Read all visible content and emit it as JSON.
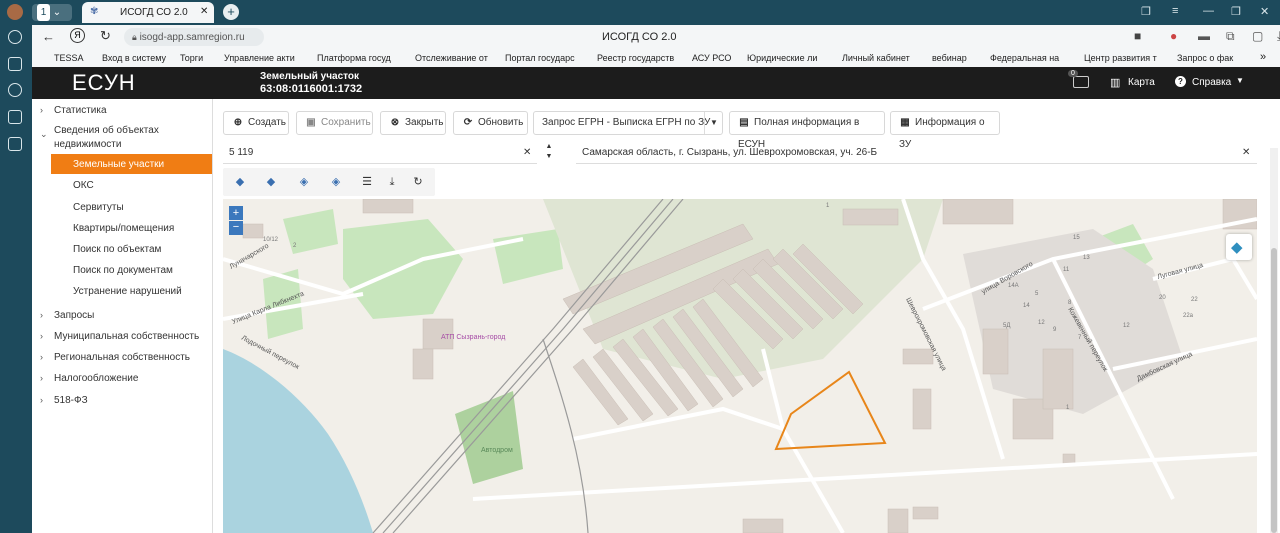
{
  "browser": {
    "tab_count": "1",
    "tab_title": "ИСОГД СО 2.0",
    "url": "isogd-app.samregion.ru",
    "page_title": "ИСОГД СО 2.0",
    "bookmarks": [
      "TESSA",
      "Вход в систему",
      "Торги",
      "Управление акти",
      "Платформа госуд",
      "Отслеживание от",
      "Портал государс",
      "Реестр государств",
      "АСУ РСО",
      "Юридические ли",
      "Личный кабинет",
      "вебинар",
      "Федеральная на",
      "Центр развития т",
      "Запрос о фак"
    ],
    "more_bookmarks": "»"
  },
  "app": {
    "logo": "ЕСУН",
    "record_type": "Земельный участок",
    "record_id": "63:08:0116001:1732",
    "notif_count": "0",
    "map_label": "Карта",
    "help_label": "Справка"
  },
  "sidebar": {
    "items": [
      {
        "label": "Статистика",
        "expanded": false
      },
      {
        "label": "Сведения об объектах недвижимости",
        "expanded": true
      },
      {
        "label": "Запросы",
        "expanded": false
      },
      {
        "label": "Муниципальная собственность",
        "expanded": false
      },
      {
        "label": "Региональная собственность",
        "expanded": false
      },
      {
        "label": "Налогообложение",
        "expanded": false
      },
      {
        "label": "518-ФЗ",
        "expanded": false
      }
    ],
    "subitems": [
      "Земельные участки",
      "ОКС",
      "Сервитуты",
      "Квартиры/помещения",
      "Поиск по объектам",
      "Поиск по документам",
      "Устранение нарушений"
    ],
    "active_subitem": "Земельные участки"
  },
  "toolbar": {
    "create": "Создать",
    "save": "Сохранить",
    "close": "Закрыть",
    "refresh": "Обновить",
    "egrn": "Запрос ЕГРН - Выписка ЕГРН по ЗУ",
    "full_info": "Полная информация в ЕСУН",
    "zu_info": "Информация о ЗУ"
  },
  "fields": {
    "area_value": "5 119",
    "address_value": "Самарская область, г. Сызрань, ул. Шеврохромовская, уч. 26-Б"
  },
  "map": {
    "zoom_in": "+",
    "zoom_out": "−",
    "labels": {
      "lunacharskogo": "Луначарского",
      "karla_libknekhta": "Улица Карла Либкнехта",
      "lodochny": "Лодочный переулок",
      "atp": "АТП Сызрань-город",
      "avtodrom": "Автодром",
      "shevrokhromovskaya": "Шеврохромовская улица",
      "vorovskogo": "улица Воровского",
      "kozhevenny": "Кожевенный переулок",
      "lugovaya": "Луговая улица",
      "dambovskaya": "Дамбовская улица"
    },
    "house_numbers": [
      "10/12",
      "2",
      "1",
      "15",
      "13",
      "11",
      "5",
      "8",
      "14А",
      "14",
      "12",
      "9",
      "7",
      "5Д",
      "20",
      "22",
      "22а",
      "12",
      "1"
    ],
    "colors": {
      "parcel_outline": "#e8861a",
      "water": "#aad3df",
      "green": "#c8e6bd",
      "building": "#d9d0c9",
      "background": "#f2efe9",
      "accent": "#f07d14"
    }
  }
}
